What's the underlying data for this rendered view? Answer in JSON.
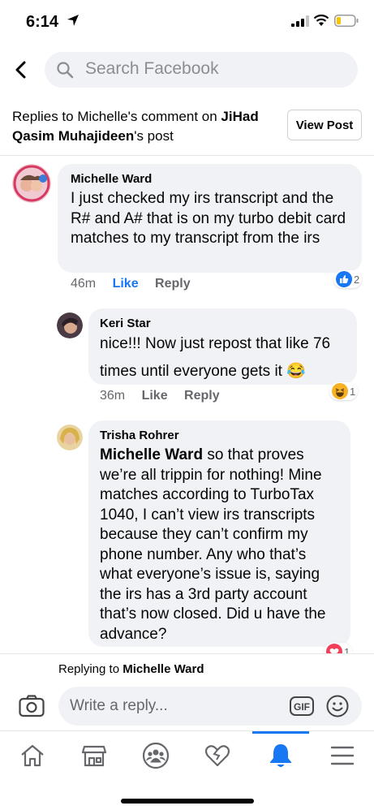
{
  "status_bar": {
    "time": "6:14"
  },
  "search": {
    "placeholder": "Search Facebook"
  },
  "context": {
    "prefix": "Replies to Michelle's comment on ",
    "author": "JiHad Qasim Muhajideen",
    "suffix": "'s post",
    "view_post_label": "View Post"
  },
  "comments": [
    {
      "author": "Michelle Ward",
      "text": "I just checked my irs transcript and the R# and A# that is on my turbo debit card matches to my transcript from the irs",
      "time": "46m",
      "like_label": "Like",
      "reply_label": "Reply",
      "reaction_icon": "like-reaction-icon",
      "reaction_count": "2"
    },
    {
      "author": "Keri Star",
      "text": "nice!!! Now just repost that like 76 times until everyone gets it 😂",
      "time": "36m",
      "like_label": "Like",
      "reply_label": "Reply",
      "reaction_icon": "haha-reaction-icon",
      "reaction_count": "1"
    },
    {
      "author": "Trisha Rohrer",
      "mention": "Michelle Ward",
      "text": " so that proves we’re all trippin for nothing! Mine matches according to TurboTax 1040, I can’t view irs transcripts because they can’t confirm my phone number. Any who that’s what everyone’s issue is, saying the irs has a 3rd party account that’s now closed. Did u have the advance?",
      "reaction_icon": "love-reaction-icon",
      "reaction_count": "1"
    }
  ],
  "reply_bar": {
    "replying_prefix": "Replying to ",
    "replying_to": "Michelle Ward",
    "placeholder": "Write a reply...",
    "gif_label": "GIF"
  },
  "tabs": [
    {
      "icon": "home-icon"
    },
    {
      "icon": "marketplace-icon"
    },
    {
      "icon": "groups-icon"
    },
    {
      "icon": "dating-icon"
    },
    {
      "icon": "notifications-icon",
      "active": true
    },
    {
      "icon": "menu-icon"
    }
  ],
  "colors": {
    "accent": "#1877f2",
    "bubble": "#f0f2f5",
    "muted": "#65676b"
  }
}
